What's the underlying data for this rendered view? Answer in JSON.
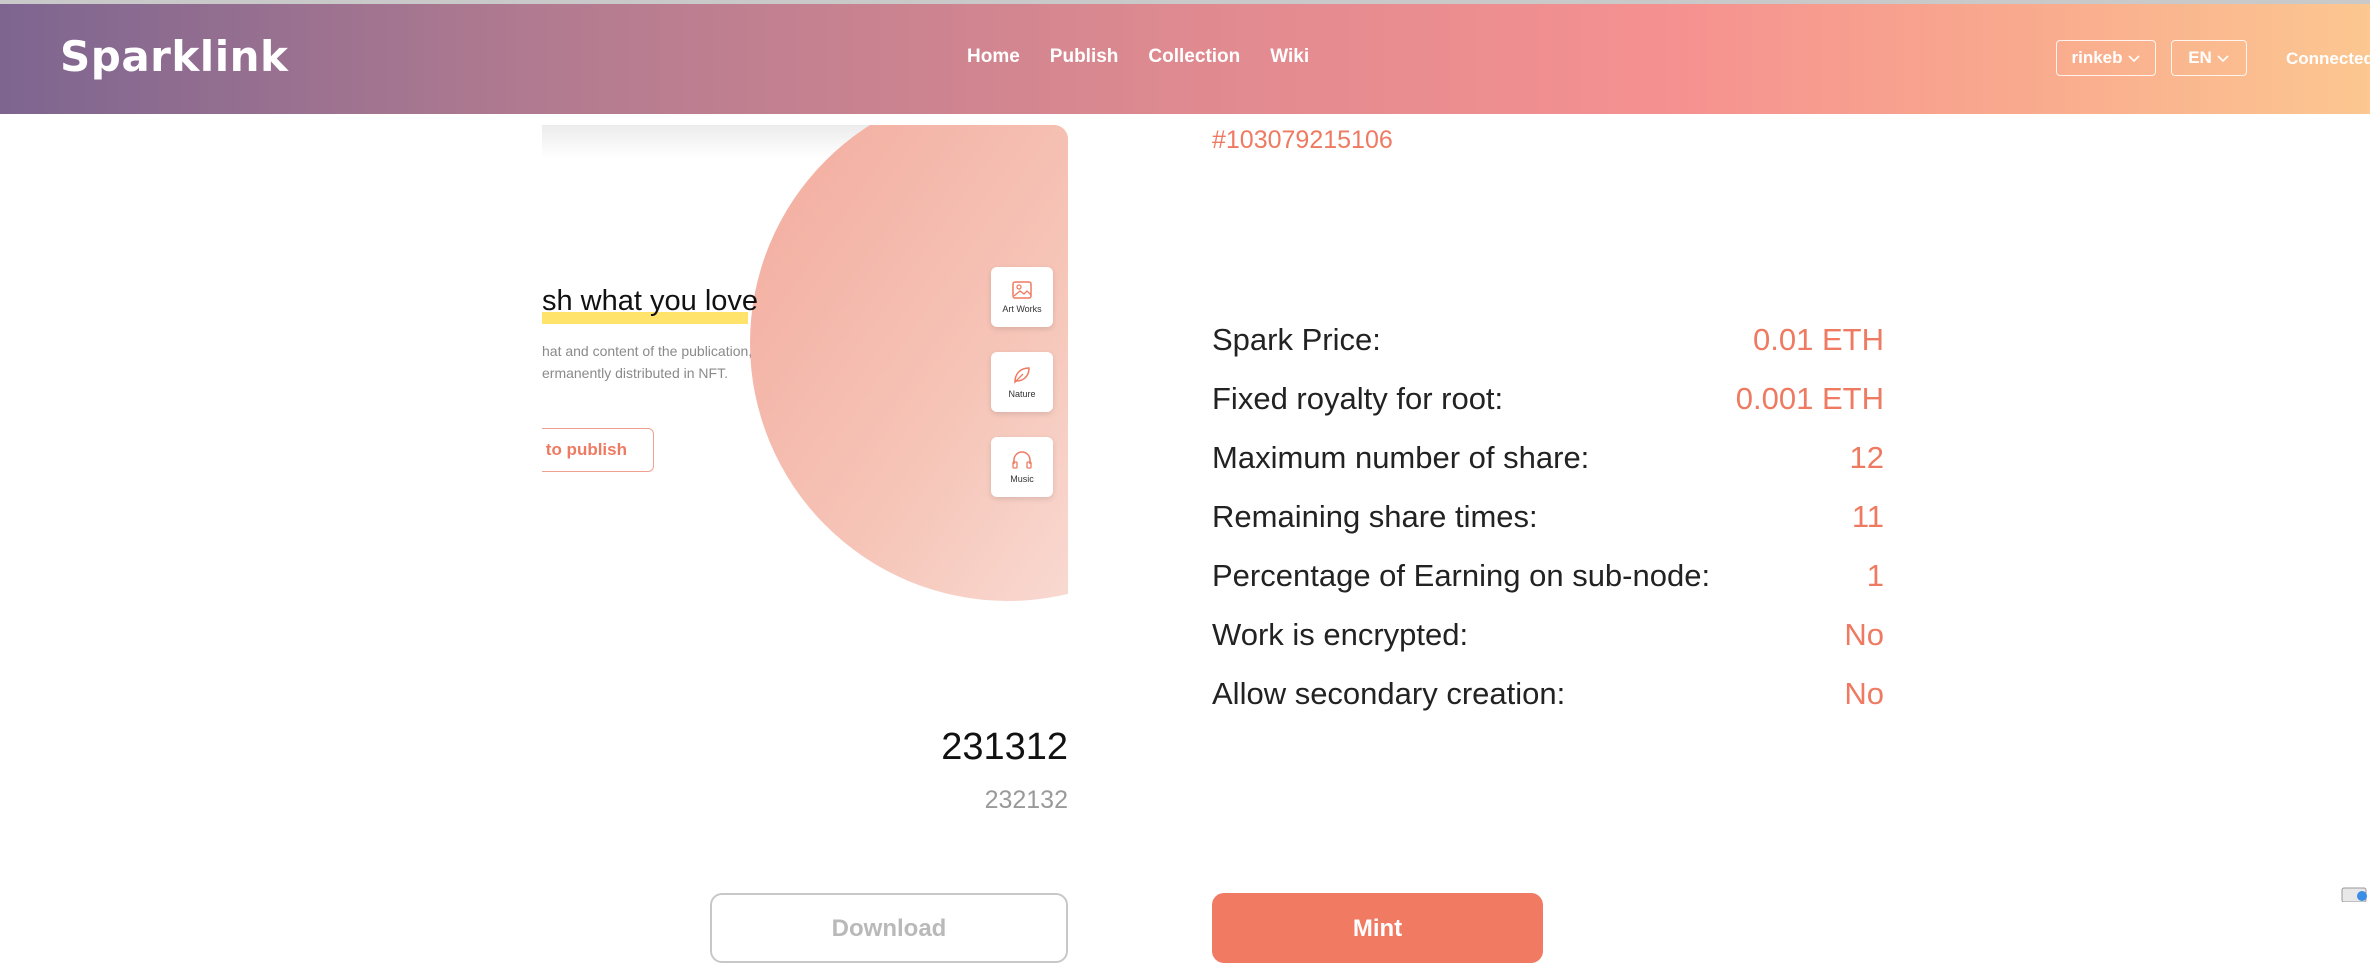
{
  "header": {
    "logo": "Sparklink",
    "nav": [
      "Home",
      "Publish",
      "Collection",
      "Wiki"
    ],
    "network": "rinkeb",
    "language": "EN",
    "wallet_status": "Connected"
  },
  "preview": {
    "headline": "sh what you love",
    "subtext_line1": "hat and content of the publication,",
    "subtext_line2": "ermanently distributed in NFT.",
    "publish_button": ": to publish",
    "categories": [
      "Art Works",
      "Nature",
      "Music"
    ]
  },
  "work": {
    "title": "231312",
    "description": "232132"
  },
  "token": {
    "id": "#103079215106"
  },
  "properties": [
    {
      "label": "Spark Price:",
      "value": "0.01 ETH"
    },
    {
      "label": "Fixed royalty for root:",
      "value": "0.001 ETH"
    },
    {
      "label": "Maximum number of share:",
      "value": "12"
    },
    {
      "label": "Remaining share times:",
      "value": "11"
    },
    {
      "label": "Percentage of Earning on sub-node:",
      "value": "1"
    },
    {
      "label": "Work is encrypted:",
      "value": "No"
    },
    {
      "label": "Allow secondary creation:",
      "value": "No"
    }
  ],
  "actions": {
    "download": "Download",
    "mint": "Mint"
  },
  "colors": {
    "accent": "#ef7a62",
    "mint_button": "#f07a62"
  }
}
